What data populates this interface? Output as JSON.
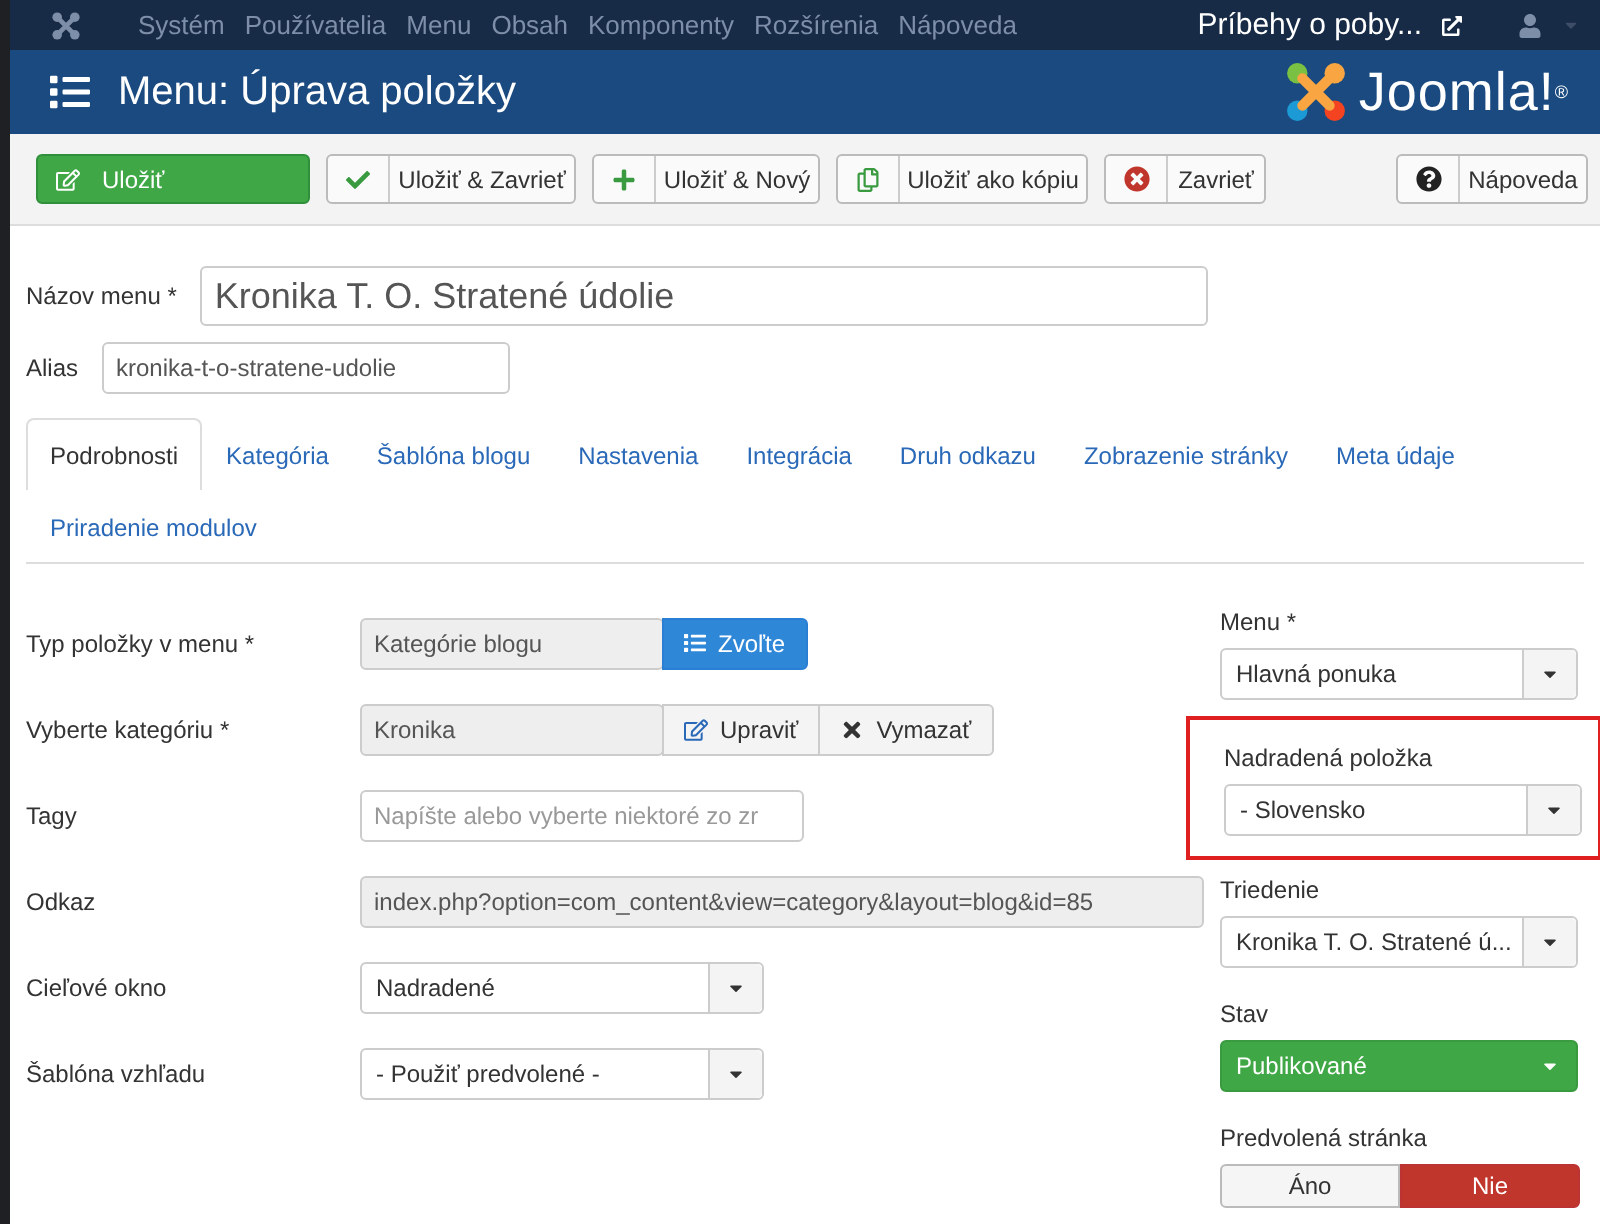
{
  "topbar": {
    "menu": [
      "Systém",
      "Používatelia",
      "Menu",
      "Obsah",
      "Komponenty",
      "Rozšírenia",
      "Nápoveda"
    ],
    "site_link": "Príbehy o poby..."
  },
  "header": {
    "title": "Menu: Úprava položky",
    "logo": "Joomla!",
    "logo_mark": "®"
  },
  "toolbar": [
    {
      "label": "Uložiť",
      "kind": "save"
    },
    {
      "label": "Uložiť & Zavrieť",
      "kind": "save-close"
    },
    {
      "label": "Uložiť & Nový",
      "kind": "save-new"
    },
    {
      "label": "Uložiť ako kópiu",
      "kind": "copy"
    },
    {
      "label": "Zavrieť",
      "kind": "close"
    },
    {
      "label": "Nápoveda",
      "kind": "help"
    }
  ],
  "title_field": {
    "label": "Názov menu *",
    "value": "Kronika T. O. Stratené údolie"
  },
  "alias_field": {
    "label": "Alias",
    "value": "kronika-t-o-stratene-udolie"
  },
  "tabs": [
    {
      "label": "Podrobnosti",
      "selected": true
    },
    {
      "label": "Kategória",
      "selected": false
    },
    {
      "label": "Šablóna blogu",
      "selected": false
    },
    {
      "label": "Nastavenia",
      "selected": false
    },
    {
      "label": "Integrácia",
      "selected": false
    },
    {
      "label": "Druh odkazu",
      "selected": false
    },
    {
      "label": "Zobrazenie stránky",
      "selected": false
    },
    {
      "label": "Meta údaje",
      "selected": false
    },
    {
      "label": "Priradenie modulov",
      "selected": false
    }
  ],
  "details": [
    {
      "kind": "addon",
      "label": "Typ položky v menu *",
      "value": "Kategórie blogu",
      "buttons": [
        "Zvoľte"
      ]
    },
    {
      "kind": "modal",
      "label": "Vyberte kategóriu *",
      "value": "Kronika",
      "buttons": [
        "Upraviť",
        "Vymazať"
      ]
    },
    {
      "kind": "tags",
      "label": "Tagy",
      "placeholder": "Napíšte alebo vyberte niektoré zo zr"
    },
    {
      "kind": "readonly",
      "label": "Odkaz",
      "value": "index.php?option=com_content&view=category&layout=blog&id=85"
    },
    {
      "kind": "select",
      "label": "Cieľové okno",
      "value": "Nadradené"
    },
    {
      "kind": "select",
      "label": "Šablóna vzhľadu",
      "value": "- Použiť predvolené -"
    }
  ],
  "sidebar": [
    {
      "kind": "select",
      "label": "Menu *",
      "value": "Hlavná ponuka",
      "highlighted": false
    },
    {
      "kind": "select",
      "label": "Nadradená položka",
      "value": "- Slovensko",
      "highlighted": true
    },
    {
      "kind": "select",
      "label": "Triedenie",
      "value": "Kronika T. O. Stratené ú...",
      "highlighted": false
    },
    {
      "kind": "status",
      "label": "Stav",
      "value": "Publikované",
      "highlighted": false
    },
    {
      "kind": "toggle",
      "label": "Predvolená stránka",
      "highlighted": false,
      "options": [
        {
          "label": "Áno",
          "selected": false
        },
        {
          "label": "Nie",
          "selected": true
        }
      ]
    }
  ]
}
